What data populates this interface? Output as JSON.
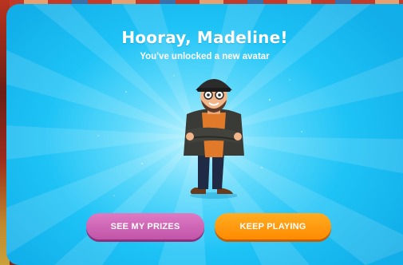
{
  "modal": {
    "title": "Hooray, Madeline!",
    "subtitle": "You've unlocked a new avatar"
  },
  "avatar": {
    "icon": "character-avatar"
  },
  "buttons": {
    "see_prizes": "SEE MY PRIZES",
    "keep_playing": "KEEP PLAYING"
  },
  "colors": {
    "modal_bg": "#1ec3f6",
    "prizes_button": "#c254a8",
    "keep_button": "#ff8a00"
  }
}
